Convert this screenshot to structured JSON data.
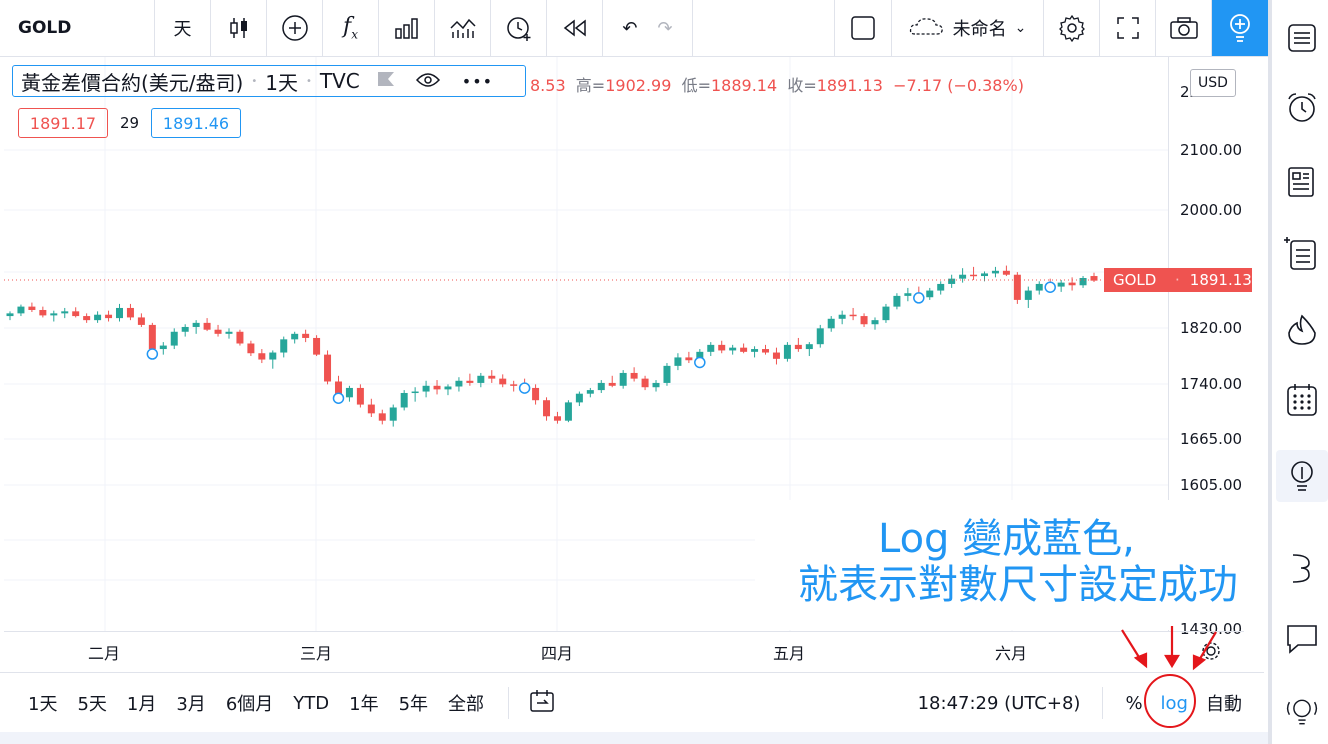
{
  "toolbar": {
    "symbol": "GOLD",
    "interval": "天",
    "layout_name": "未命名",
    "caret": "⌄"
  },
  "legend": {
    "title": "黃金差價合約(美元/盎司)",
    "interval": "1天",
    "source": "TVC",
    "ohlc_open_tail": "8.53",
    "high_label": "高=",
    "high": "1902.99",
    "low_label": "低=",
    "low": "1889.14",
    "close_label": "收=",
    "close": "1891.13",
    "change": "−7.17 (−0.38%)",
    "bid": "1891.17",
    "spread": "29",
    "ask": "1891.46"
  },
  "price_axis": {
    "currency": "USD",
    "labels": [
      "2100.00",
      "2000.00",
      "1820.00",
      "1740.00",
      "1665.00",
      "1605.00",
      "1430.00"
    ],
    "top_partial": "2200.0",
    "current_symbol": "GOLD",
    "current_price": "1891.13"
  },
  "time_axis": {
    "months": [
      "二月",
      "三月",
      "四月",
      "五月",
      "六月"
    ]
  },
  "bottom_bar": {
    "ranges": [
      "1天",
      "5天",
      "1月",
      "3月",
      "6個月",
      "YTD",
      "1年",
      "5年",
      "全部"
    ],
    "clock": "18:47:29 (UTC+8)",
    "percent": "%",
    "log": "log",
    "auto": "自動"
  },
  "annotation": {
    "line1": "Log 變成藍色,",
    "line2": "就表示對數尺寸設定成功"
  },
  "colors": {
    "up": "#26a69a",
    "down": "#ef5350",
    "accent": "#2196f3",
    "annot_red": "#e4161b"
  },
  "icons": {
    "right_sidebar": [
      "watchlist-icon",
      "alarm-icon",
      "news-icon",
      "calendar-list-icon",
      "hotlist-icon",
      "calendar-icon",
      "ideas-icon",
      "streams-icon",
      "chat-icon",
      "signal-icon"
    ]
  },
  "chart_data": {
    "type": "candlestick",
    "scale": "log",
    "x_labels": [
      "二月",
      "三月",
      "四月",
      "五月",
      "六月"
    ],
    "candles": [
      [
        1838,
        1845,
        1832,
        1842
      ],
      [
        1842,
        1855,
        1838,
        1852
      ],
      [
        1852,
        1858,
        1844,
        1847
      ],
      [
        1847,
        1852,
        1836,
        1839
      ],
      [
        1839,
        1846,
        1830,
        1842
      ],
      [
        1842,
        1850,
        1835,
        1845
      ],
      [
        1845,
        1851,
        1836,
        1838
      ],
      [
        1838,
        1842,
        1828,
        1832
      ],
      [
        1832,
        1845,
        1828,
        1840
      ],
      [
        1840,
        1846,
        1830,
        1835
      ],
      [
        1835,
        1856,
        1830,
        1850
      ],
      [
        1850,
        1856,
        1832,
        1836
      ],
      [
        1836,
        1842,
        1822,
        1825
      ],
      [
        1825,
        1828,
        1780,
        1790
      ],
      [
        1790,
        1800,
        1782,
        1795
      ],
      [
        1795,
        1820,
        1790,
        1815
      ],
      [
        1815,
        1826,
        1808,
        1822
      ],
      [
        1822,
        1832,
        1812,
        1828
      ],
      [
        1828,
        1835,
        1816,
        1818
      ],
      [
        1818,
        1825,
        1808,
        1812
      ],
      [
        1812,
        1820,
        1805,
        1815
      ],
      [
        1815,
        1818,
        1795,
        1798
      ],
      [
        1798,
        1802,
        1780,
        1784
      ],
      [
        1784,
        1790,
        1770,
        1775
      ],
      [
        1775,
        1788,
        1762,
        1785
      ],
      [
        1785,
        1808,
        1778,
        1804
      ],
      [
        1804,
        1815,
        1798,
        1812
      ],
      [
        1812,
        1818,
        1800,
        1806
      ],
      [
        1806,
        1810,
        1780,
        1782
      ],
      [
        1782,
        1788,
        1740,
        1744
      ],
      [
        1744,
        1752,
        1718,
        1722
      ],
      [
        1722,
        1738,
        1716,
        1735
      ],
      [
        1735,
        1740,
        1708,
        1712
      ],
      [
        1712,
        1720,
        1695,
        1700
      ],
      [
        1700,
        1705,
        1685,
        1690
      ],
      [
        1690,
        1712,
        1682,
        1708
      ],
      [
        1708,
        1732,
        1704,
        1728
      ],
      [
        1728,
        1736,
        1716,
        1730
      ],
      [
        1730,
        1745,
        1722,
        1738
      ],
      [
        1738,
        1746,
        1726,
        1733
      ],
      [
        1733,
        1740,
        1725,
        1737
      ],
      [
        1737,
        1750,
        1730,
        1745
      ],
      [
        1745,
        1755,
        1738,
        1742
      ],
      [
        1742,
        1756,
        1736,
        1752
      ],
      [
        1752,
        1760,
        1742,
        1748
      ],
      [
        1748,
        1754,
        1736,
        1740
      ],
      [
        1740,
        1745,
        1730,
        1738
      ],
      [
        1738,
        1748,
        1732,
        1735
      ],
      [
        1735,
        1740,
        1712,
        1718
      ],
      [
        1718,
        1722,
        1690,
        1696
      ],
      [
        1696,
        1702,
        1686,
        1690
      ],
      [
        1690,
        1718,
        1688,
        1715
      ],
      [
        1715,
        1730,
        1710,
        1727
      ],
      [
        1727,
        1735,
        1722,
        1732
      ],
      [
        1732,
        1746,
        1728,
        1742
      ],
      [
        1742,
        1752,
        1736,
        1738
      ],
      [
        1738,
        1760,
        1734,
        1756
      ],
      [
        1756,
        1764,
        1744,
        1748
      ],
      [
        1748,
        1752,
        1732,
        1736
      ],
      [
        1736,
        1746,
        1730,
        1742
      ],
      [
        1742,
        1770,
        1738,
        1766
      ],
      [
        1766,
        1784,
        1760,
        1778
      ],
      [
        1778,
        1786,
        1770,
        1774
      ],
      [
        1774,
        1790,
        1768,
        1786
      ],
      [
        1786,
        1800,
        1780,
        1796
      ],
      [
        1796,
        1802,
        1784,
        1788
      ],
      [
        1788,
        1796,
        1782,
        1792
      ],
      [
        1792,
        1798,
        1784,
        1786
      ],
      [
        1786,
        1794,
        1778,
        1790
      ],
      [
        1790,
        1796,
        1782,
        1785
      ],
      [
        1785,
        1792,
        1768,
        1776
      ],
      [
        1776,
        1800,
        1772,
        1796
      ],
      [
        1796,
        1806,
        1786,
        1790
      ],
      [
        1790,
        1800,
        1780,
        1797
      ],
      [
        1797,
        1825,
        1792,
        1820
      ],
      [
        1820,
        1838,
        1815,
        1834
      ],
      [
        1834,
        1846,
        1826,
        1840
      ],
      [
        1840,
        1850,
        1832,
        1838
      ],
      [
        1838,
        1842,
        1822,
        1826
      ],
      [
        1826,
        1836,
        1818,
        1832
      ],
      [
        1832,
        1856,
        1828,
        1852
      ],
      [
        1852,
        1872,
        1848,
        1868
      ],
      [
        1868,
        1880,
        1860,
        1872
      ],
      [
        1872,
        1882,
        1862,
        1866
      ],
      [
        1866,
        1880,
        1862,
        1876
      ],
      [
        1876,
        1890,
        1870,
        1886
      ],
      [
        1886,
        1900,
        1880,
        1894
      ],
      [
        1894,
        1910,
        1888,
        1900
      ],
      [
        1900,
        1912,
        1892,
        1898
      ],
      [
        1898,
        1905,
        1890,
        1902
      ],
      [
        1902,
        1912,
        1896,
        1906
      ],
      [
        1906,
        1914,
        1898,
        1900
      ],
      [
        1900,
        1904,
        1856,
        1862
      ],
      [
        1862,
        1882,
        1850,
        1876
      ],
      [
        1876,
        1890,
        1870,
        1886
      ],
      [
        1886,
        1894,
        1878,
        1882
      ],
      [
        1882,
        1892,
        1874,
        1888
      ],
      [
        1888,
        1896,
        1876,
        1884
      ],
      [
        1884,
        1898,
        1880,
        1895
      ],
      [
        1898,
        1903,
        1889,
        1891
      ]
    ],
    "markers": [
      "二月",
      "三月",
      "三月",
      "四月",
      "四月",
      "五月",
      "六月"
    ]
  }
}
